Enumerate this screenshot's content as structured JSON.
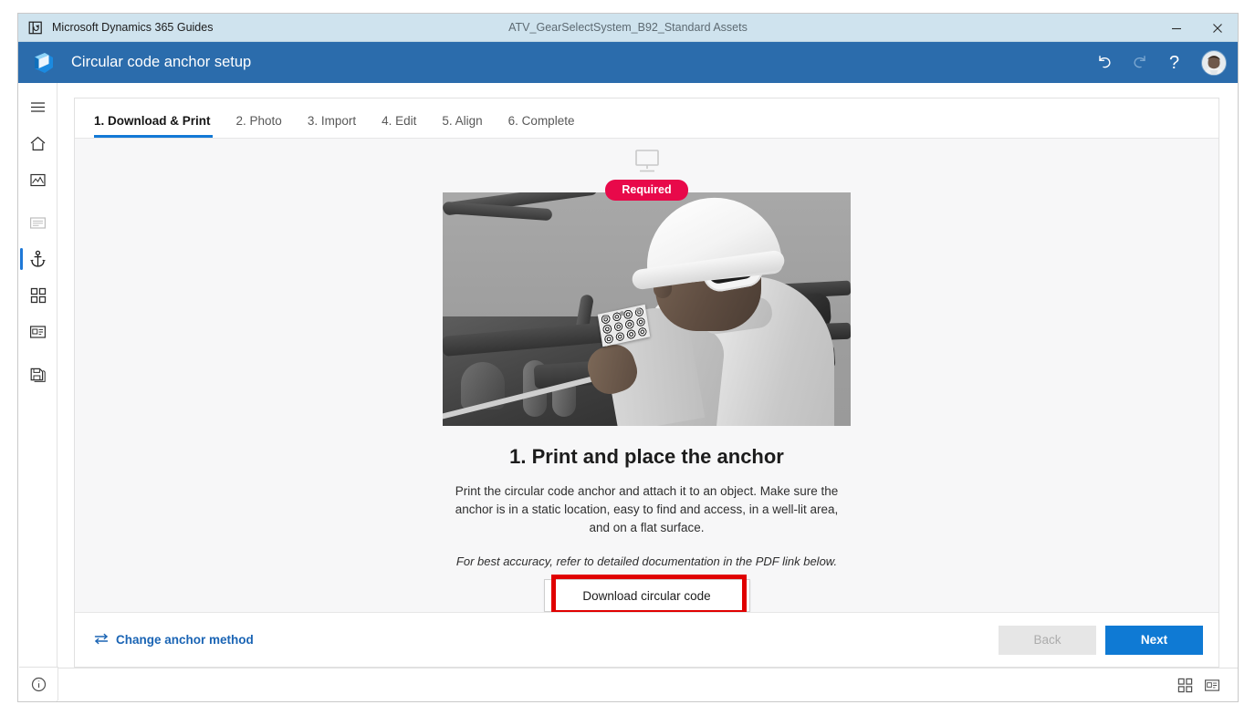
{
  "titlebar": {
    "app_name": "Microsoft Dynamics 365 Guides",
    "document_name": "ATV_GearSelectSystem_B92_Standard Assets",
    "app_icon": "guides-app-icon",
    "minimize_label": "Minimize",
    "close_label": "Close"
  },
  "header": {
    "title": "Circular code anchor setup",
    "logo": "dynamics365-logo",
    "undo_icon": "undo-icon",
    "redo_icon": "redo-icon",
    "help_label": "?",
    "avatar": "user-avatar",
    "bg_color": "#2b6cac"
  },
  "rail": {
    "items": [
      {
        "name": "menu",
        "icon": "hamburger-menu-icon",
        "state": "default"
      },
      {
        "name": "home",
        "icon": "home-icon",
        "state": "default"
      },
      {
        "name": "media",
        "icon": "image-icon",
        "state": "default"
      },
      {
        "name": "steps",
        "icon": "text-lines-icon",
        "state": "disabled"
      },
      {
        "name": "anchor",
        "icon": "anchor-icon",
        "state": "selected"
      },
      {
        "name": "apps",
        "icon": "grid-four-squares-icon",
        "state": "default"
      },
      {
        "name": "card",
        "icon": "card-form-icon",
        "state": "default"
      },
      {
        "name": "save",
        "icon": "copy-save-icon",
        "state": "default"
      }
    ],
    "info_icon": "info-circle-icon",
    "selected_accent": "#1e78d7"
  },
  "tabs": {
    "items": [
      {
        "label": "1. Download & Print",
        "active": true
      },
      {
        "label": "2. Photo",
        "active": false
      },
      {
        "label": "3. Import",
        "active": false
      },
      {
        "label": "4. Edit",
        "active": false
      },
      {
        "label": "5. Align",
        "active": false
      },
      {
        "label": "6. Complete",
        "active": false
      }
    ],
    "active_underline_color": "#1379d6"
  },
  "content": {
    "device_icon": "desktop-monitor-icon",
    "badge": {
      "label": "Required",
      "color": "#e8094a"
    },
    "illustration": {
      "name": "worker-placing-circular-code-anchor-photo",
      "description": "Grayscale render of a worker in a hard hat and face mask holding a printed circular code sheet next to an ATV gear select system frame"
    },
    "heading": "1. Print and place the anchor",
    "paragraph": "Print the circular code anchor and attach it to an object. Make sure the anchor is in a static location, easy to find and access, in a well-lit area, and on a flat surface.",
    "note": "For best accuracy, refer to detailed documentation in the PDF link below.",
    "download_button": "Download circular code",
    "annotation_color": "#e00000"
  },
  "footer": {
    "change_anchor_method": "Change anchor method",
    "change_anchor_icon": "swap-arrows-icon",
    "back_label": "Back",
    "back_disabled": true,
    "next_label": "Next",
    "next_color": "#0f7ad4",
    "link_color": "#1a64b4"
  },
  "statusbar": {
    "info_icon": "info-circle-icon",
    "apps_icon": "grid-four-squares-icon",
    "card_icon": "card-form-icon"
  }
}
